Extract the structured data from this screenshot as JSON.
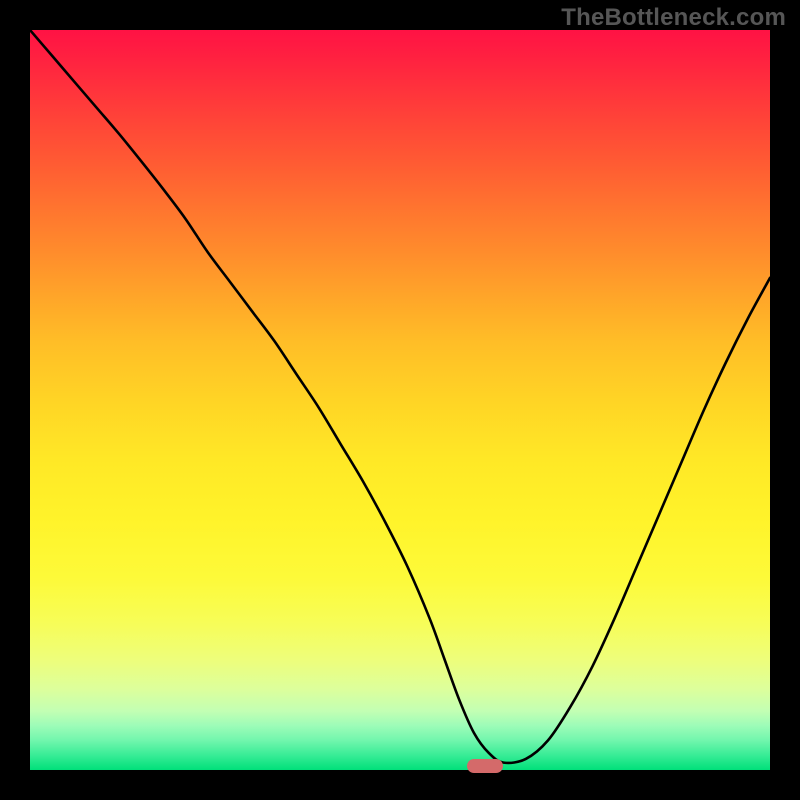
{
  "watermark": "TheBottleneck.com",
  "chart_data": {
    "type": "line",
    "title": "",
    "xlabel": "",
    "ylabel": "",
    "xlim": [
      0,
      100
    ],
    "ylim": [
      0,
      100
    ],
    "grid": false,
    "series": [
      {
        "name": "bottleneck-curve",
        "color": "#000000",
        "x": [
          0,
          3,
          6,
          9,
          12,
          15,
          18,
          21,
          24,
          27,
          30,
          33,
          36,
          39,
          42,
          45,
          48,
          51,
          54,
          56,
          58,
          60,
          62,
          64,
          67,
          70,
          73,
          76,
          79,
          82,
          85,
          88,
          91,
          94,
          97,
          100
        ],
        "y": [
          100,
          96.5,
          93,
          89.5,
          86,
          82.3,
          78.5,
          74.5,
          70,
          66,
          62,
          58,
          53.5,
          49,
          44,
          39,
          33.5,
          27.5,
          20.5,
          15,
          9.5,
          5,
          2.3,
          1,
          1.5,
          4,
          8.5,
          14,
          20.5,
          27.5,
          34.5,
          41.5,
          48.5,
          55,
          61,
          66.5
        ]
      }
    ],
    "marker": {
      "x": 61.5,
      "y": 0.5,
      "color": "#d46a6a",
      "shape": "pill"
    },
    "background_gradient": {
      "direction": "vertical",
      "stops": [
        {
          "pos": 0,
          "color": "#ff1244"
        },
        {
          "pos": 50,
          "color": "#ffd425"
        },
        {
          "pos": 80,
          "color": "#f7fd57"
        },
        {
          "pos": 100,
          "color": "#00e07a"
        }
      ]
    }
  }
}
